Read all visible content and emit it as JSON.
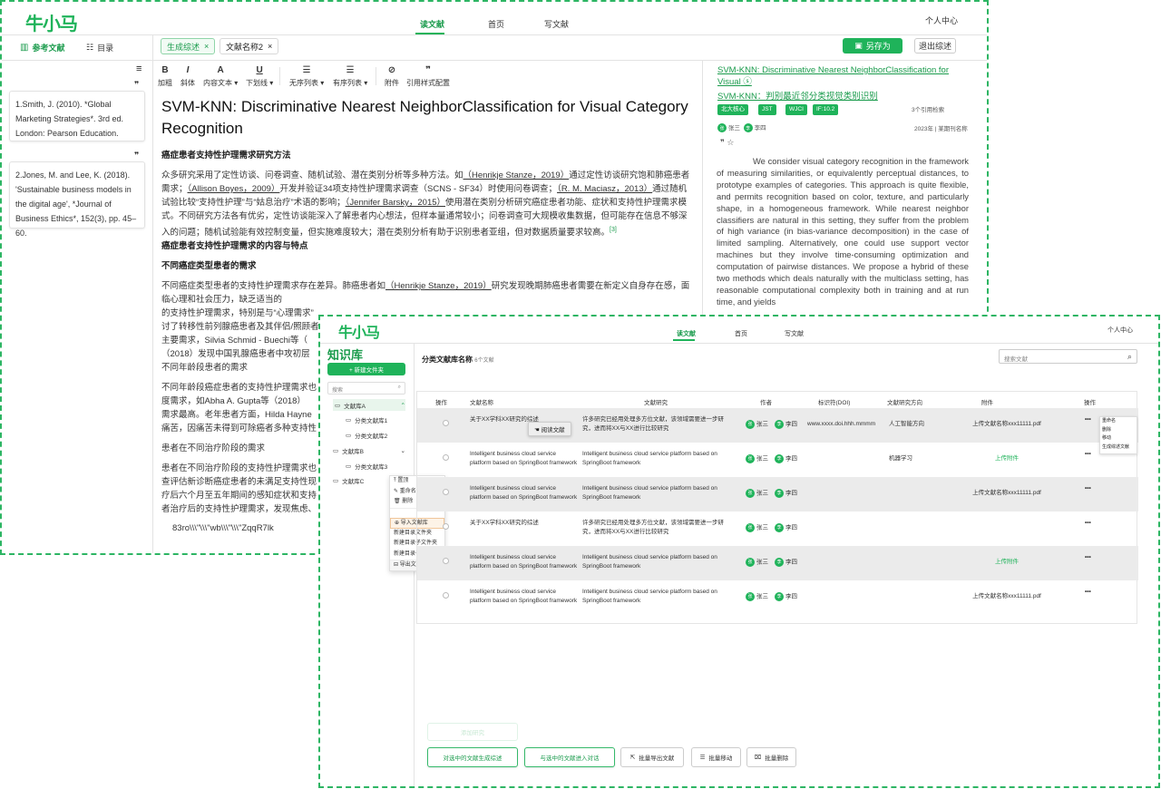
{
  "win1": {
    "logo": "牛小马",
    "nav": [
      "读文献",
      "首页",
      "写文献"
    ],
    "user": "个人中心",
    "sidebar_tabs": [
      "参考文献",
      "目录"
    ],
    "tabs": [
      "生成综述",
      "文献名称2"
    ],
    "save_btn": "另存为",
    "exit_btn": "退出综述",
    "refs": [
      "1.Smith, J. (2010). *Global Marketing Strategies*. 3rd ed. London: Pearson Education.",
      "2.Jones, M. and Lee, K. (2018). 'Sustainable business models in the digital age', *Journal of Business Ethics*, 152(3), pp. 45–60."
    ],
    "toolbar": [
      "加粗",
      "斜体",
      "内容文本",
      "下划线",
      "无序列表",
      "有序列表",
      "附件",
      "引用样式配置"
    ],
    "toolbar_icons": [
      "B",
      "I",
      "A",
      "U",
      "☰",
      "☰",
      "⊘",
      "❞"
    ],
    "doc": {
      "title": "SVM-KNN: Discriminative Nearest NeighborClassification for Visual Category Recognition",
      "h1": "癌症患者支持性护理需求研究方法",
      "p1a": "众多研究采用了定性访谈、问卷调查、随机试验、潜在类别分析等多种方法。如",
      "c1": "（Henrikje Stanze，2019）",
      "p1b": "通过定性访谈研究饱和肺癌患者需求；",
      "c2": "（Allison Boyes，2009）",
      "p1c": "开发并验证34项支持性护理需求调查（SCNS - SF34）时使用问卷调查；",
      "c3": "（R. M. Maciasz，2013）",
      "p1d": "通过随机试验比较“支持性护理”与“姑息治疗”术语的影响；",
      "c4": "（Jennifer Barsky，2015）",
      "p1e": "使用潜在类别分析研究癌症患者功能、症状和支持性护理需求模式。不同研究方法各有优劣，定性访谈能深入了解患者内心想法，但样本量通常较小；问卷调查可大规模收集数据，但可能存在信息不够深入的问题；随机试验能有效控制变量，但实施难度较大；潜在类别分析有助于识别患者亚组，但对数据质量要求较高。",
      "sup": "[3]",
      "h2": "癌症患者支持性护理需求的内容与特点",
      "h3": "不同癌症类型患者的需求",
      "p2a": "不同癌症类型患者的支持性护理需求存在差异。肺癌患者如",
      "c5": "（Henrikje Stanze，2019）",
      "p2b": "研究发现晚期肺癌患者需要在新定义自身存在感，面临心理和社会压力，缺乏适当的",
      "p2c": "的支持性护理需求，特别是与“心理需求”",
      "p2d": "讨了转移性前列腺癌患者及其伴侣/照顾者",
      "p2e": "主要需求，Silvia Schmid - Buechi等（",
      "p2f": "（2018）发现中国乳腺癌患者中攻初层",
      "h4": "不同年龄段患者的需求",
      "p3a": "不同年龄段癌症患者的支持性护理需求也",
      "p3b": "度需求，如Abha A. Gupta等（2018）",
      "p3c": "需求最高。老年患者方面，Hilda Hayne",
      "p3d": "痛苦，因痛苦未得到可除癌者多种支持性",
      "h5": "患者在不同治疗阶段的需求",
      "p4a": "患者在不同治疗阶段的支持性护理需求也",
      "p4b": "查评估新诊断癌症患者的未满足支持性现",
      "p4c": "疗后六个月至五年期间的感知症状和支持",
      "p4d": "者治疗后的支持性护理需求，发现焦虑、",
      "p5": "83ro\\\\\\\"\\\\\\\"wb\\\\\\\"\\\\\\\"ZqqR7lk"
    },
    "right": {
      "title1": "SVM-KNN: Discriminative Nearest NeighborClassification for Visual",
      "title2": "SVM-KNN：判别最近邻分类视觉类别识别",
      "chips": [
        "北大核心",
        "JST",
        "WJCI",
        "IF:10.2"
      ],
      "cited": "3个引用检索",
      "authors": [
        "张三",
        "李四"
      ],
      "year": "2023年",
      "source": "某期刊名称",
      "abstract": "We consider visual category recognition in the framework of measuring similarities, or equivalently perceptual distances, to prototype examples of categories. This approach is quite flexible, and permits recognition based on color, texture, and particularly shape, in a homogeneous framework. While nearest neighbor classifiers are natural in this setting, they suffer from the problem of high variance (in bias-variance decomposition) in the case of limited sampling. Alternatively, one could use support vector machines but they involve time-consuming optimization and computation of pairwise distances. We propose a hybrid of these two methods which deals naturally with the multiclass setting, has reasonable computational complexity both in training and at run time, and yields"
    }
  },
  "win2": {
    "logo": "牛小马",
    "nav": [
      "读文献",
      "首页",
      "写文献"
    ],
    "user": "个人中心",
    "lib_title": "知识库",
    "new_folder": "+ 新建文件夹",
    "search_placeholder": "搜索",
    "tree": [
      "文献库A",
      "分类文献库1",
      "分类文献库2",
      "文献库B",
      "分类文献库3",
      "文献库C"
    ],
    "ctx_menu": [
      "置顶",
      "重命名",
      "删除",
      "导入文献库",
      "新建目录文件夹",
      "新建目录子文件夹",
      "导出文献库"
    ],
    "category_title": "分类文献库名称",
    "category_count": "6个文献",
    "search_doc_placeholder": "搜索文献",
    "columns": [
      "操作",
      "文献名称",
      "文献研究",
      "作者",
      "标识符(DOI)",
      "文献研究方向",
      "附件",
      "操作"
    ],
    "read_btn": "阅读文献",
    "rows": [
      {
        "name": "关于XX学科XX研究的综述",
        "summary": "许多研究已经用处理多方位文献，该领域需要进一步研究，进而将XX与XX进行比较研究",
        "a1": "张三",
        "a2": "李四",
        "doi": "www.xxxx.doi.hhh.mmmm",
        "dir": "人工智能方向",
        "file": "上传文献名称xxx11111.pdf"
      },
      {
        "name": "Intelligent business cloud service platform based on SpringBoot framework",
        "summary": "Intelligent business cloud service platform based on SpringBoot framework",
        "a1": "张三",
        "a2": "李四",
        "doi": "",
        "dir": "机器学习",
        "file": "上传附件"
      },
      {
        "name": "Intelligent business cloud service platform based on SpringBoot framework",
        "summary": "Intelligent business cloud service platform based on SpringBoot framework",
        "a1": "张三",
        "a2": "李四",
        "doi": "",
        "dir": "",
        "file": "上传文献名称xxx11111.pdf"
      },
      {
        "name": "关于XX学科XX研究的综述",
        "summary": "许多研究已经用处理多方位文献，该领域需要进一步研究，进而将XX与XX进行比较研究",
        "a1": "张三",
        "a2": "李四",
        "doi": "",
        "dir": "",
        "file": ""
      },
      {
        "name": "Intelligent business cloud service platform based on SpringBoot framework",
        "summary": "Intelligent business cloud service platform based on SpringBoot framework",
        "a1": "张三",
        "a2": "李四",
        "doi": "",
        "dir": "",
        "file": "上传附件"
      },
      {
        "name": "Intelligent business cloud service platform based on SpringBoot framework",
        "summary": "Intelligent business cloud service platform based on SpringBoot framework",
        "a1": "张三",
        "a2": "李四",
        "doi": "",
        "dir": "",
        "file": "上传文献名称xxx11111.pdf"
      }
    ],
    "row_menu": [
      "重命名",
      "删除",
      "移动",
      "生成综述文献"
    ],
    "more": "•••",
    "bottom": {
      "ghost": "添加研究",
      "b1": "对选中的文献生成综述",
      "b2": "与选中的文献进入对话",
      "b3": "批量导出文献",
      "b4": "批量移动",
      "b5": "批量删除"
    }
  },
  "colors": {
    "brand": "#1fb35a",
    "border": "#2db563"
  }
}
